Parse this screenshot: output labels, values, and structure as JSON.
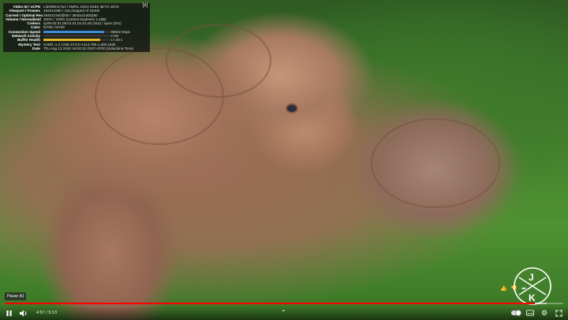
{
  "stats_for_nerds": {
    "close_label": "[x]",
    "rows": [
      {
        "label": "Video ID / sCPN",
        "value": "L3D9Nkm7wJ / 5WRL 2SH2 6S6S 3E7H 4ZVK"
      },
      {
        "label": "Viewport / Frames",
        "value": "1920x1080 / 115 dropped of 18400"
      },
      {
        "label": "Current / Optimal Res",
        "value": "3840x2160@60 / 3840x2160@60"
      },
      {
        "label": "Volume / Normalized",
        "value": "100% / 100% (content loudness 1.4dB)"
      },
      {
        "label": "Codecs",
        "value": "vp09.00.51.08.01.01.01.01.00 (315) / opus (251)"
      },
      {
        "label": "Color",
        "value": "bt709 / bt709"
      },
      {
        "label": "Connection Speed",
        "value": "98602 Kbps"
      },
      {
        "label": "Network Activity",
        "value": "0 KB"
      },
      {
        "label": "Buffer Health",
        "value": "17.29 s"
      },
      {
        "label": "Mystery Text",
        "value": "SABR, s:4 t:236.24 b:0-1413.795 L:abk:1638"
      },
      {
        "label": "Date",
        "value": "Thu Aug 13 2020 16:00:10 GMT+0700 (Indochina Time)"
      }
    ],
    "connection_fill": 0.92,
    "network_fill": 0.0,
    "buffer_fill": 0.86
  },
  "tooltip": {
    "text": "Pause (k)"
  },
  "watermark": {
    "letters": [
      "J",
      "K"
    ]
  },
  "player": {
    "current_time": "4:57",
    "duration": "5:13",
    "progress": 0.949,
    "buffered": 0.97
  },
  "controls": {
    "play_pause_icon": "pause-icon",
    "volume_icon": "volume-icon",
    "autoplay_icon": "autoplay-toggle",
    "subtitles_icon": "subtitles-icon",
    "settings_icon": "gear-icon",
    "fullscreen_icon": "fullscreen-icon"
  }
}
